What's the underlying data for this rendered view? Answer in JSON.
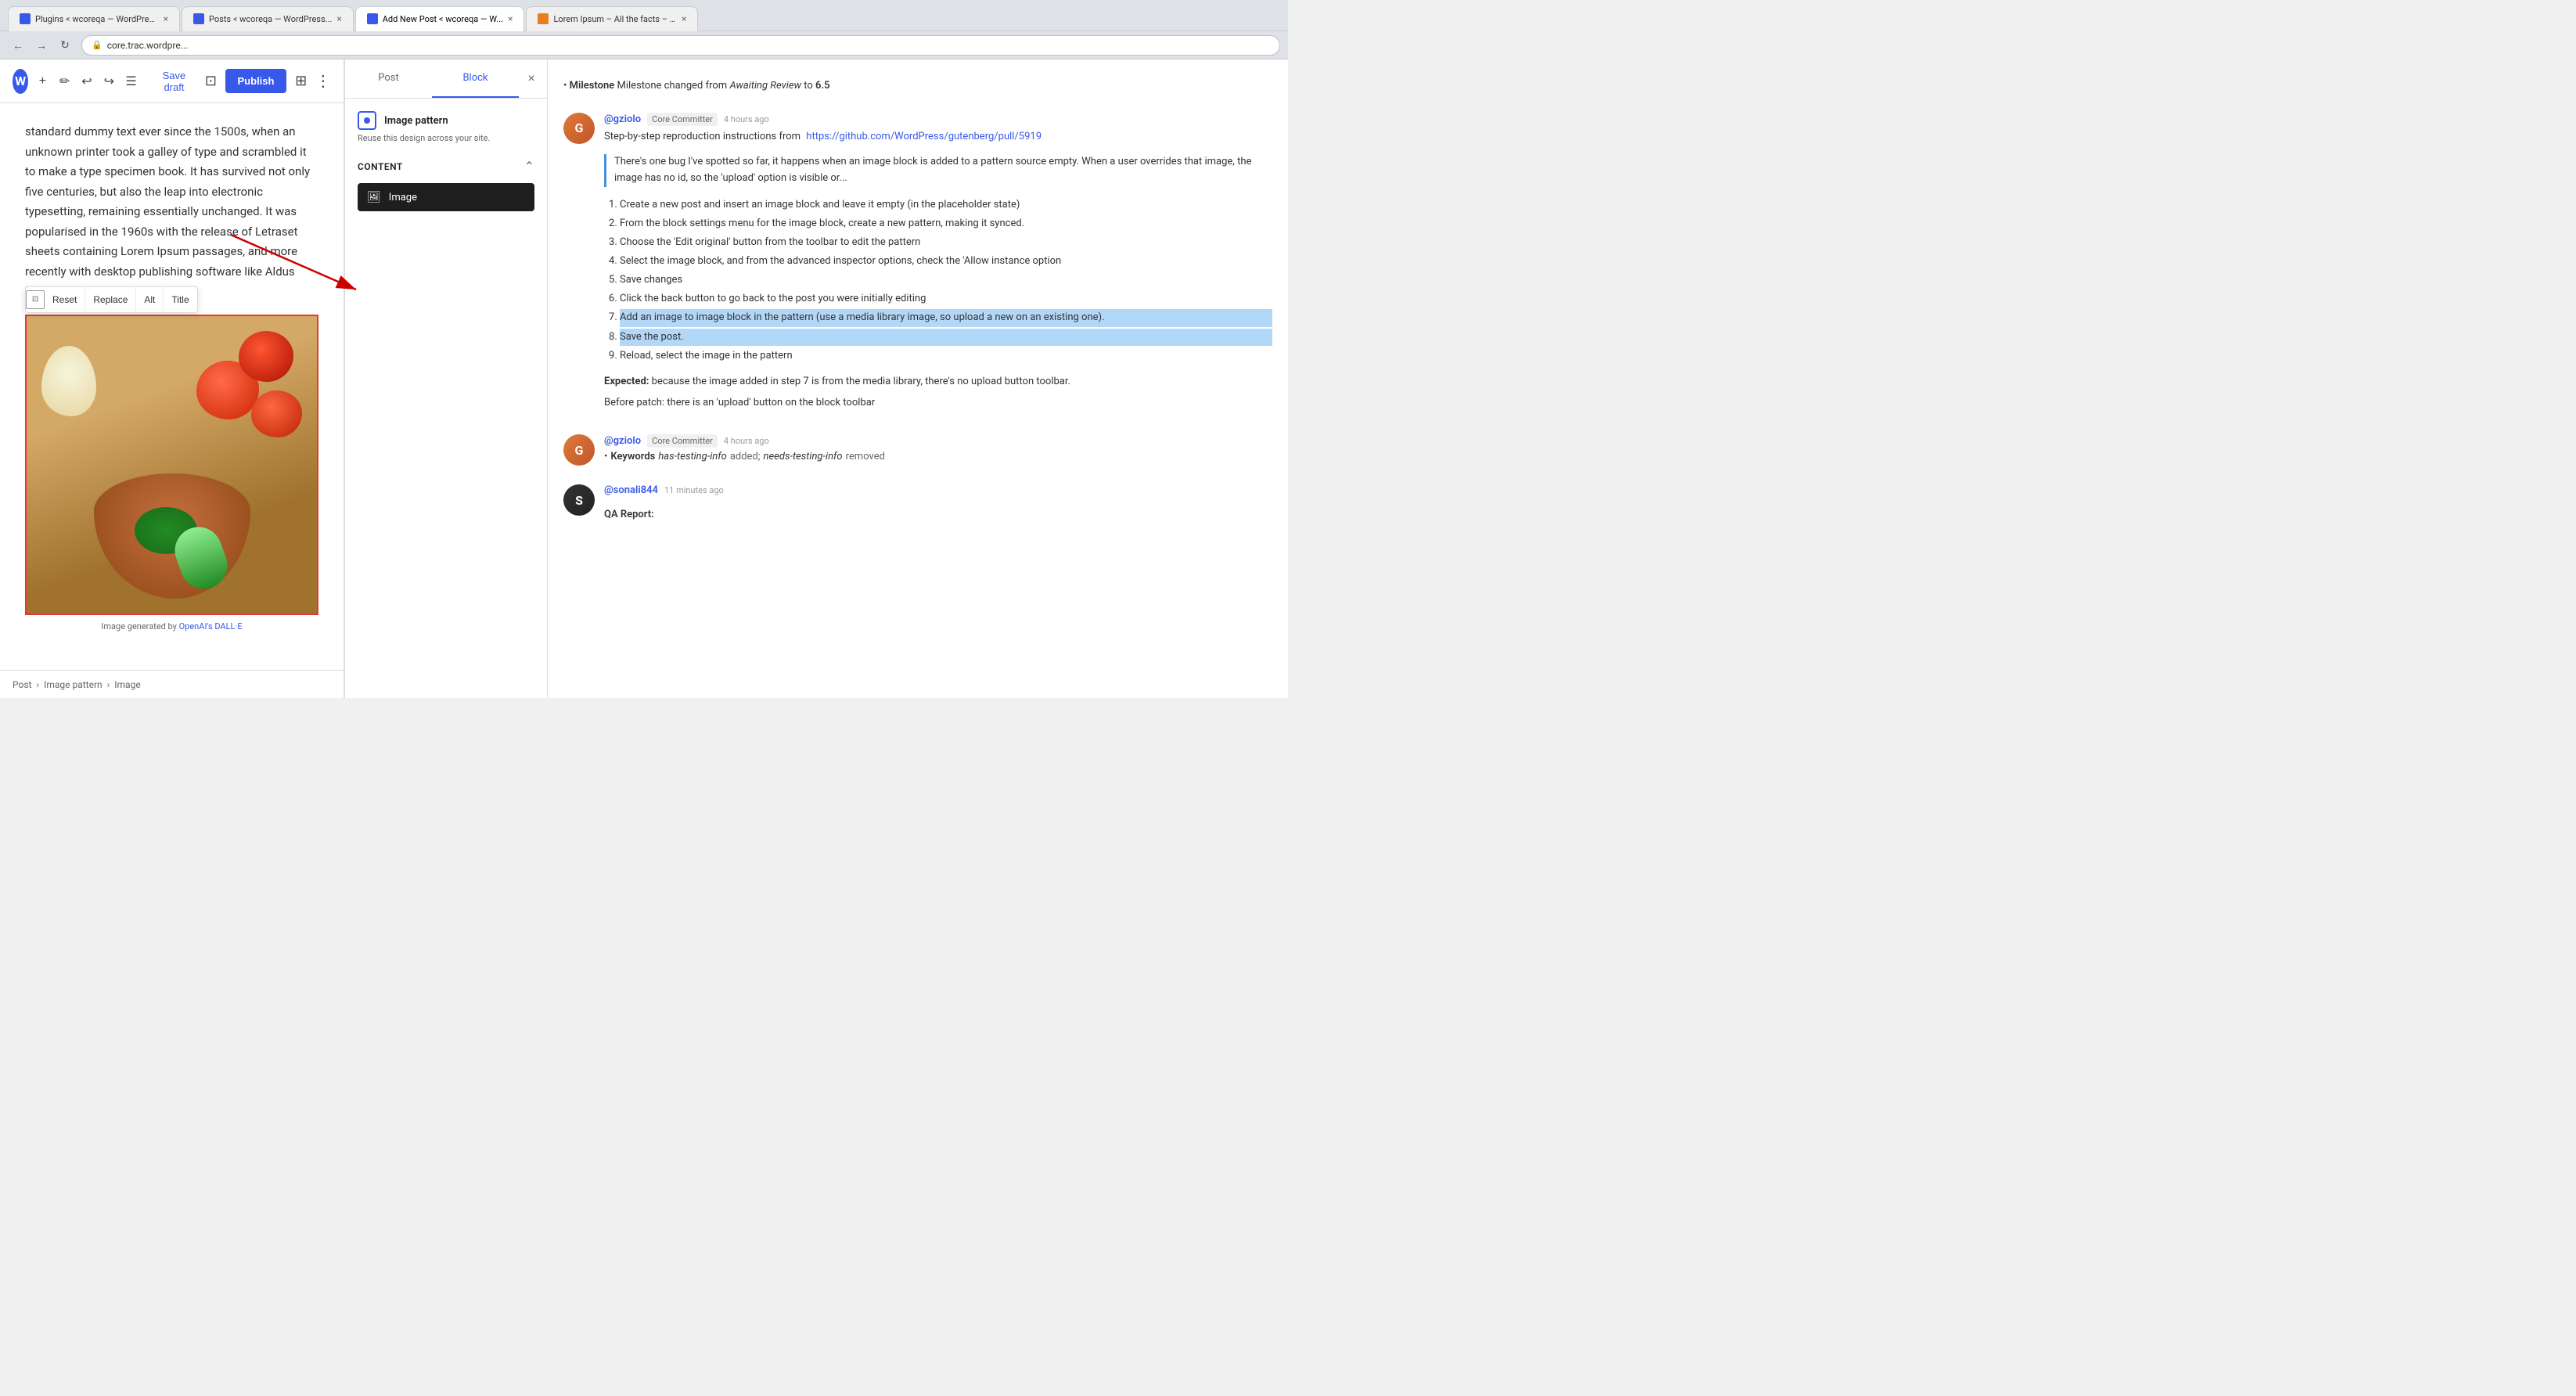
{
  "browser": {
    "tabs": [
      {
        "id": "tab1",
        "title": "Plugins < wcoreqa — WordPress...",
        "favicon": "wp",
        "active": false
      },
      {
        "id": "tab2",
        "title": "Posts < wcoreqa — WordPress...",
        "favicon": "wp",
        "active": false
      },
      {
        "id": "tab3",
        "title": "Add New Post < wcoreqa — W...",
        "favicon": "wp",
        "active": true
      },
      {
        "id": "tab4",
        "title": "Lorem Ipsum – All the facts – Li...",
        "favicon": "li",
        "active": false
      }
    ],
    "address": "core.trac.wordpre...",
    "secure": true
  },
  "editor": {
    "toolbar": {
      "save_draft": "Save draft",
      "publish": "Publish"
    },
    "content": {
      "text": "standard dummy text ever since the 1500s, when an unknown printer took a galley of type and scrambled it to make a type specimen book. It has survived not only five centuries, but also the leap into electronic typesetting, remaining essentially unchanged. It was popularised in the 1960s with the release of Letraset sheets containing Lorem Ipsum passages, and more recently with desktop publishing software like Aldus PageMaker..."
    },
    "image_toolbar": {
      "reset": "Reset",
      "replace": "Replace",
      "alt": "Alt",
      "title": "Title"
    },
    "image_caption": "Image generated by",
    "image_caption_link": "OpenAI's DALL·E",
    "breadcrumb": {
      "post": "Post",
      "separator1": "›",
      "image_pattern": "Image pattern",
      "separator2": "›",
      "image": "Image"
    }
  },
  "block_panel": {
    "tabs": {
      "post": "Post",
      "block": "Block"
    },
    "image_pattern": {
      "title": "Image pattern",
      "description": "Reuse this design across your site."
    },
    "content": {
      "title": "Content",
      "image_label": "Image"
    }
  },
  "trac": {
    "milestone_change": {
      "text": "Milestone changed from",
      "from": "Awaiting Review",
      "to_text": "to",
      "to": "6.5"
    },
    "comment1": {
      "author": "@gziolo",
      "role": "Core Committer",
      "time": "4 hours ago",
      "intro": "Step-by-step reproduction instructions from",
      "link_text": "https://github.com/WordPress/gutenberg/pull/5919",
      "main_text": "There's one bug I've spotted so far, it happens when an image block is added to a pattern source empty. When a user overrides that image, the image has no id, so the 'upload' option is visible or...",
      "instructions": [
        "Create a new post and insert an image block and leave it empty (in the placeholder state)",
        "From the block settings menu for the image block, create a new pattern, making it synced.",
        "Choose the 'Edit original' button from the toolbar to edit the pattern",
        "Select the image block, and from the advanced inspector options, check the 'Allow instance option",
        "Save changes",
        "Click the back button to go back to the post you were initially editing",
        "Add an image to image block in the pattern (use a media library image, so upload a new on an existing one).",
        "Save the post.",
        "Reload, select the image in the pattern"
      ],
      "instructions_highlighted": [
        7,
        8
      ],
      "expected_title": "Expected:",
      "expected_text": "because the image added in step 7 is from the media library, there's no upload button toolbar.",
      "before_patch": "Before patch: there is an 'upload' button on the block toolbar"
    },
    "comment2": {
      "author": "@gziolo",
      "role": "Core Committer",
      "time": "4 hours ago",
      "keywords_bold": "Keywords",
      "keywords_added_code": "has-testing-info",
      "keywords_added_text": "added;",
      "keywords_removed_code": "needs-testing-info",
      "keywords_removed_text": "removed"
    },
    "comment3": {
      "author": "@sonali844",
      "time": "11 minutes ago",
      "qa_report": "QA Report:"
    }
  }
}
